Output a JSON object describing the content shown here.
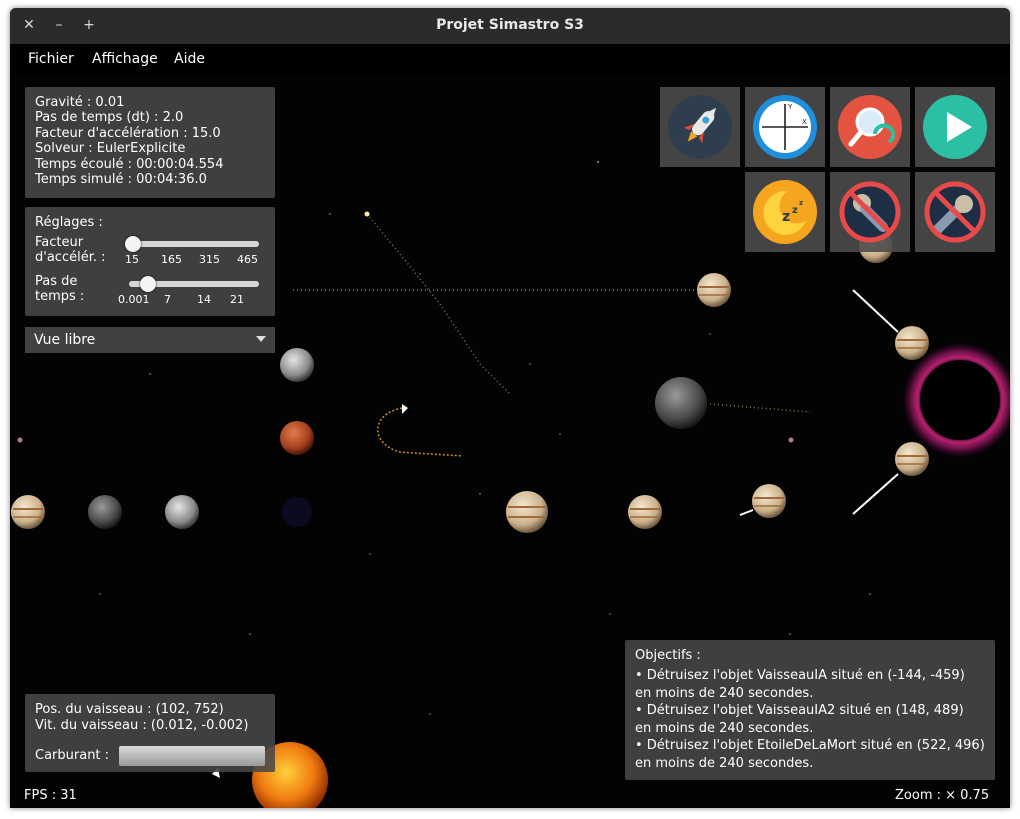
{
  "window": {
    "title": "Projet Simastro S3",
    "close": "✕",
    "minimize": "–",
    "maximize": "+"
  },
  "menu": {
    "items": [
      "Fichier",
      "Affichage",
      "Aide"
    ]
  },
  "info": {
    "gravity": "Gravité : 0.01",
    "dt": "Pas de temps (dt) : 2.0",
    "accel": "Facteur d'accélération : 15.0",
    "solver": "Solveur : EulerExplicite",
    "elapsed": "Temps écoulé : 00:00:04.554",
    "simulated": "Temps simulé : 00:04:36.0"
  },
  "settings": {
    "title": "Réglages :",
    "accel_label_1": "Facteur",
    "accel_label_2": "d'accélér. :",
    "accel_ticks": [
      "15",
      "165",
      "315",
      "465"
    ],
    "accel_value": 15,
    "accel_range": [
      15,
      465
    ],
    "dt_label_1": "Pas de",
    "dt_label_2": "temps :",
    "dt_ticks": [
      "0.001",
      "7",
      "14",
      "21"
    ],
    "dt_value": 2.0,
    "dt_range": [
      0.001,
      21
    ]
  },
  "view_select": {
    "selected": "Vue libre"
  },
  "tools": [
    {
      "icon": "rocket-icon"
    },
    {
      "icon": "axes-icon"
    },
    {
      "icon": "zoom-reset-icon"
    },
    {
      "icon": "play-icon"
    },
    {
      "icon": "sleep-icon"
    },
    {
      "icon": "no-satellite-icon"
    },
    {
      "icon": "no-comet-icon"
    }
  ],
  "ship": {
    "position": "Pos. du vaisseau : (102, 752)",
    "velocity": "Vit. du vaisseau : (0.012, -0.002)",
    "fuel_label": "Carburant :",
    "fuel_level": 1.0
  },
  "objectives": {
    "title": "Objectifs :",
    "items": [
      {
        "line1": "• Détruisez l'objet VaisseauIA situé en (-144, -459)",
        "line2": "en moins de 240 secondes."
      },
      {
        "line1": "• Détruisez l'objet VaisseauIA2 situé en (148, 489)",
        "line2": "en moins de 240 secondes."
      },
      {
        "line1": "• Détruisez l'objet EtoileDeLaMort situé en (522, 496)",
        "line2": "en moins de 240 secondes."
      }
    ]
  },
  "status": {
    "fps": "FPS : 31",
    "zoom": "Zoom : × 0.75"
  },
  "colors": {
    "panel": "#484848",
    "play": "#2bbfa3",
    "axes": "#1f8fdc",
    "sleep": "#f6a51f",
    "ban": "#e84a4a"
  }
}
